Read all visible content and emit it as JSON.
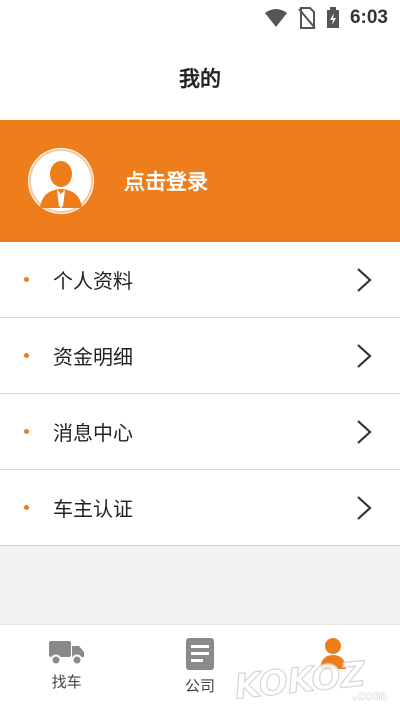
{
  "status_bar": {
    "time": "6:03"
  },
  "header": {
    "title": "我的"
  },
  "profile": {
    "login_label": "点击登录"
  },
  "menu": {
    "items": [
      {
        "label": "个人资料"
      },
      {
        "label": "资金明细"
      },
      {
        "label": "消息中心"
      },
      {
        "label": "车主认证"
      }
    ]
  },
  "tabbar": {
    "tabs": [
      {
        "label": "找车",
        "icon": "truck-icon"
      },
      {
        "label": "公司",
        "icon": "document-icon"
      },
      {
        "label": "",
        "icon": "person-icon",
        "active": true
      }
    ]
  },
  "watermark": {
    "text": "KOKOZ.com"
  },
  "colors": {
    "accent": "#ee7d1b",
    "background": "#f2f2f2"
  }
}
